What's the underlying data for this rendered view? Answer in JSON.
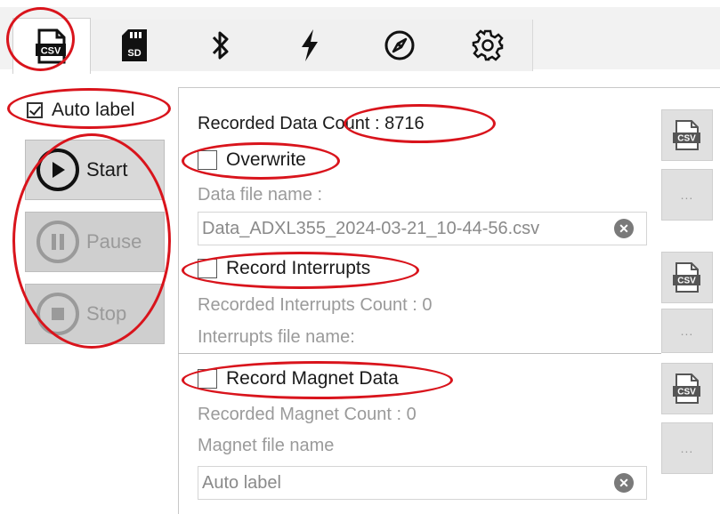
{
  "tabs": [
    {
      "name": "csv",
      "icon": "csv-file-icon",
      "label": "CSV",
      "active": true
    },
    {
      "name": "sd",
      "icon": "sd-card-icon",
      "label": "SD"
    },
    {
      "name": "bluetooth",
      "icon": "bluetooth-icon"
    },
    {
      "name": "power",
      "icon": "lightning-icon"
    },
    {
      "name": "compass",
      "icon": "compass-icon"
    },
    {
      "name": "settings",
      "icon": "gear-icon"
    }
  ],
  "left": {
    "auto_label": "Auto label",
    "auto_label_checked": true,
    "start": "Start",
    "pause": "Pause",
    "stop": "Stop"
  },
  "data_section": {
    "recorded_prefix": "Recorded Data",
    "count_text": "Count : 8716",
    "overwrite": "Overwrite",
    "file_label": "Data file name :",
    "file_value": "Data_ADXL355_2024-03-21_10-44-56.csv"
  },
  "interrupts_section": {
    "record_label": "Record Interrupts",
    "count_text": "Recorded Interrupts Count : 0",
    "file_label": "Interrupts file name:"
  },
  "magnet_section": {
    "record_label": "Record Magnet Data",
    "count_text": "Recorded Magnet Count : 0",
    "file_label": "Magnet file name",
    "file_value": "Auto label"
  },
  "side_buttons": {
    "csv_label": "CSV",
    "dots": "..."
  },
  "clear_glyph": "✕",
  "colors": {
    "annotation": "#d9141c",
    "disabled_text": "#9a9a9a",
    "button_bg": "#d9d9d9"
  }
}
